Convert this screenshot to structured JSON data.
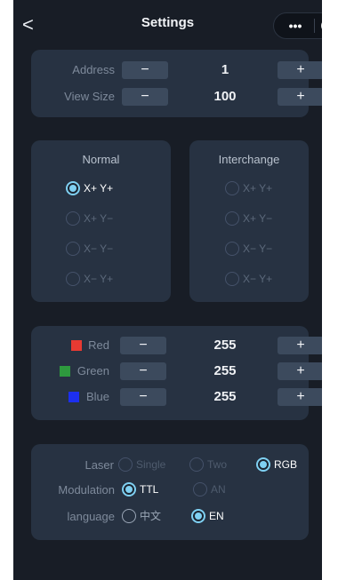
{
  "header": {
    "title": "Settings",
    "back": "<",
    "more": "•••"
  },
  "address": {
    "label": "Address",
    "value": "1",
    "minus": "−",
    "plus": "+"
  },
  "view_size": {
    "label": "View Size",
    "value": "100",
    "minus": "−",
    "plus": "+"
  },
  "normal": {
    "title": "Normal",
    "options": [
      "X+ Y+",
      "X+ Y−",
      "X− Y−",
      "X− Y+"
    ],
    "selected": 0
  },
  "interchange": {
    "title": "Interchange",
    "options": [
      "X+ Y+",
      "X+ Y−",
      "X− Y−",
      "X− Y+"
    ],
    "selected": -1
  },
  "colors": [
    {
      "label": "Red",
      "value": "255",
      "swatch": "#e83a32",
      "minus": "−",
      "plus": "+"
    },
    {
      "label": "Green",
      "value": "255",
      "swatch": "#2e9a3e",
      "minus": "−",
      "plus": "+"
    },
    {
      "label": "Blue",
      "value": "255",
      "swatch": "#1c2ff0",
      "minus": "−",
      "plus": "+"
    }
  ],
  "laser": {
    "label": "Laser",
    "options": [
      "Single",
      "Two",
      "RGB"
    ],
    "selected": 2
  },
  "modulation": {
    "label": "Modulation",
    "options": [
      "TTL",
      "AN"
    ],
    "selected": 0
  },
  "language": {
    "label": "language",
    "options": [
      "中文",
      "EN"
    ],
    "selected": 1
  },
  "theme": {
    "accent": "#7fd0f2",
    "background": "#181d26",
    "card": "#273242",
    "button": "#3c4a5d"
  }
}
